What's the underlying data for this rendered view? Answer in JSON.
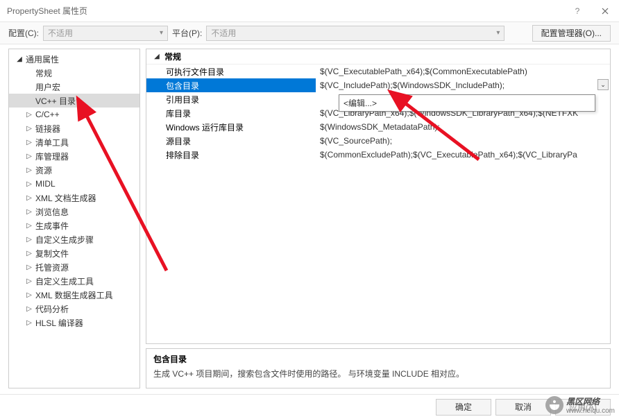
{
  "window": {
    "title": "PropertySheet 属性页"
  },
  "toolbar": {
    "config_label": "配置(C):",
    "config_value": "不适用",
    "platform_label": "平台(P):",
    "platform_value": "不适用",
    "manager_btn": "配置管理器(O)..."
  },
  "tree": {
    "root": "通用属性",
    "items": [
      {
        "label": "常规",
        "expandable": false
      },
      {
        "label": "用户宏",
        "expandable": false
      },
      {
        "label": "VC++ 目录",
        "expandable": false,
        "selected": true
      },
      {
        "label": "C/C++",
        "expandable": true
      },
      {
        "label": "链接器",
        "expandable": true
      },
      {
        "label": "清单工具",
        "expandable": true
      },
      {
        "label": "库管理器",
        "expandable": true
      },
      {
        "label": "资源",
        "expandable": true
      },
      {
        "label": "MIDL",
        "expandable": true
      },
      {
        "label": "XML 文档生成器",
        "expandable": true
      },
      {
        "label": "浏览信息",
        "expandable": true
      },
      {
        "label": "生成事件",
        "expandable": true
      },
      {
        "label": "自定义生成步骤",
        "expandable": true
      },
      {
        "label": "复制文件",
        "expandable": true
      },
      {
        "label": "托管资源",
        "expandable": true
      },
      {
        "label": "自定义生成工具",
        "expandable": true
      },
      {
        "label": "XML 数据生成器工具",
        "expandable": true
      },
      {
        "label": "代码分析",
        "expandable": true
      },
      {
        "label": "HLSL 编译器",
        "expandable": true
      }
    ]
  },
  "grid": {
    "section": "常规",
    "rows": [
      {
        "label": "可执行文件目录",
        "value": "$(VC_ExecutablePath_x64);$(CommonExecutablePath)"
      },
      {
        "label": "包含目录",
        "value": "$(VC_IncludePath);$(WindowsSDK_IncludePath);",
        "selected": true
      },
      {
        "label": "引用目录",
        "value": ""
      },
      {
        "label": "库目录",
        "value": "$(VC_LibraryPath_x64);$(WindowsSDK_LibraryPath_x64);$(NETFXK"
      },
      {
        "label": "Windows 运行库目录",
        "value": "$(WindowsSDK_MetadataPath);"
      },
      {
        "label": "源目录",
        "value": "$(VC_SourcePath);"
      },
      {
        "label": "排除目录",
        "value": "$(CommonExcludePath);$(VC_ExecutablePath_x64);$(VC_LibraryPa"
      }
    ],
    "dropdown_item": "<编辑...>"
  },
  "desc": {
    "title": "包含目录",
    "body": "生成 VC++ 项目期间，搜索包含文件时使用的路径。  与环境变量 INCLUDE 相对应。"
  },
  "footer": {
    "ok": "确定",
    "cancel": "取消",
    "apply": "应用(A)"
  },
  "watermark": {
    "text": "黑区网络",
    "sub": "www.heiqu.com"
  }
}
